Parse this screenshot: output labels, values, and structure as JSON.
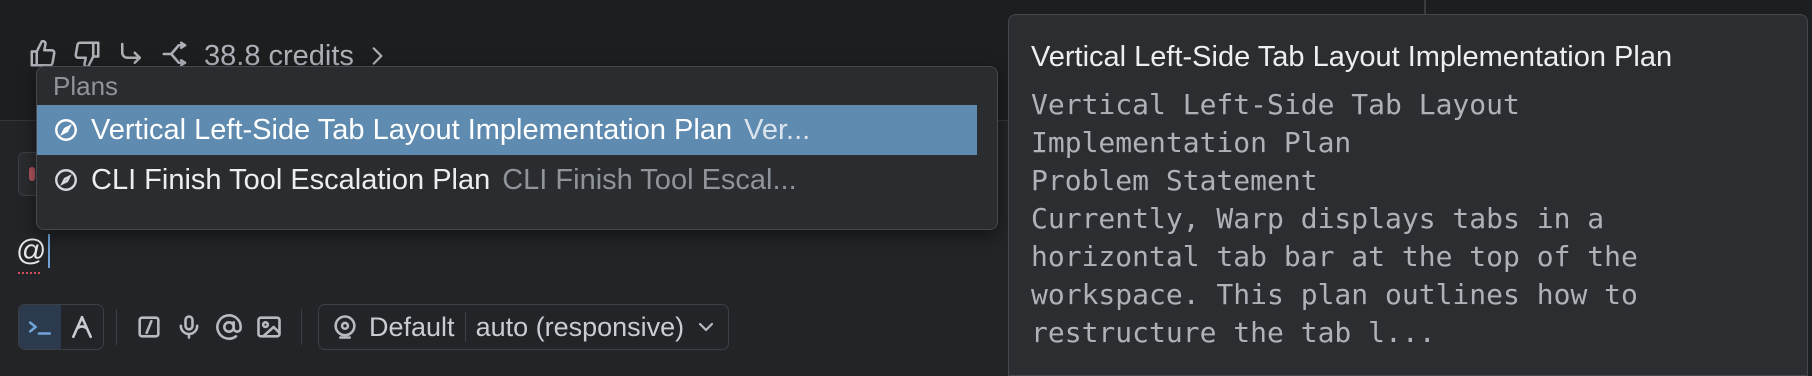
{
  "feedback_bar": {
    "credits_label": "38.8 credits",
    "icons": [
      "thumbs-up-icon",
      "thumbs-down-icon",
      "share-icon",
      "branch-icon",
      "chevron-right-icon"
    ]
  },
  "plans_menu": {
    "header": "Plans",
    "items": [
      {
        "title": "Vertical Left-Side Tab Layout Implementation Plan",
        "preview": "Ver...",
        "selected": true
      },
      {
        "title": "CLI Finish Tool Escalation Plan",
        "preview": "CLI Finish Tool Escal...",
        "selected": false
      }
    ]
  },
  "input": {
    "value": "@"
  },
  "toolbar": {
    "model_profile": "Default",
    "model_name": "auto (responsive)"
  },
  "preview": {
    "title": "Vertical Left-Side Tab Layout Implementation Plan",
    "body": "Vertical Left-Side Tab Layout\nImplementation Plan\nProblem Statement\nCurrently, Warp displays tabs in a\nhorizontal tab bar at the top of the\nworkspace. This plan outlines how to\nrestructure the tab l..."
  },
  "colors": {
    "background": "#1d1e20",
    "selection": "#5f8bb0",
    "accent_blue": "#6fa3d8"
  }
}
